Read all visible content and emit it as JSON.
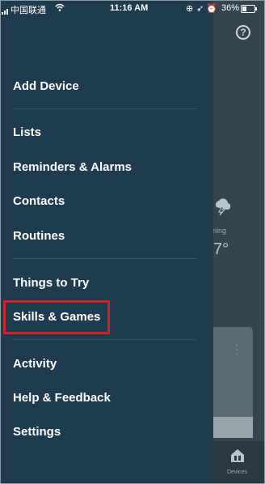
{
  "status_bar": {
    "carrier": "中国联通",
    "time": "11:16 AM",
    "battery": "36%",
    "battery_level": 0.36
  },
  "drawer": {
    "items": [
      {
        "label": "Add Device"
      },
      {
        "label": "Lists"
      },
      {
        "label": "Reminders & Alarms"
      },
      {
        "label": "Contacts"
      },
      {
        "label": "Routines"
      },
      {
        "label": "Things to Try"
      },
      {
        "label": "Skills & Games"
      },
      {
        "label": "Activity"
      },
      {
        "label": "Help & Feedback"
      },
      {
        "label": "Settings"
      }
    ],
    "highlighted_item": "Skills & Games",
    "highlight_color": "#d0202a"
  },
  "background": {
    "weather_condition": "ning",
    "weather_temp": "7°",
    "nav_devices_label": "Devices",
    "help_icon": "?"
  }
}
